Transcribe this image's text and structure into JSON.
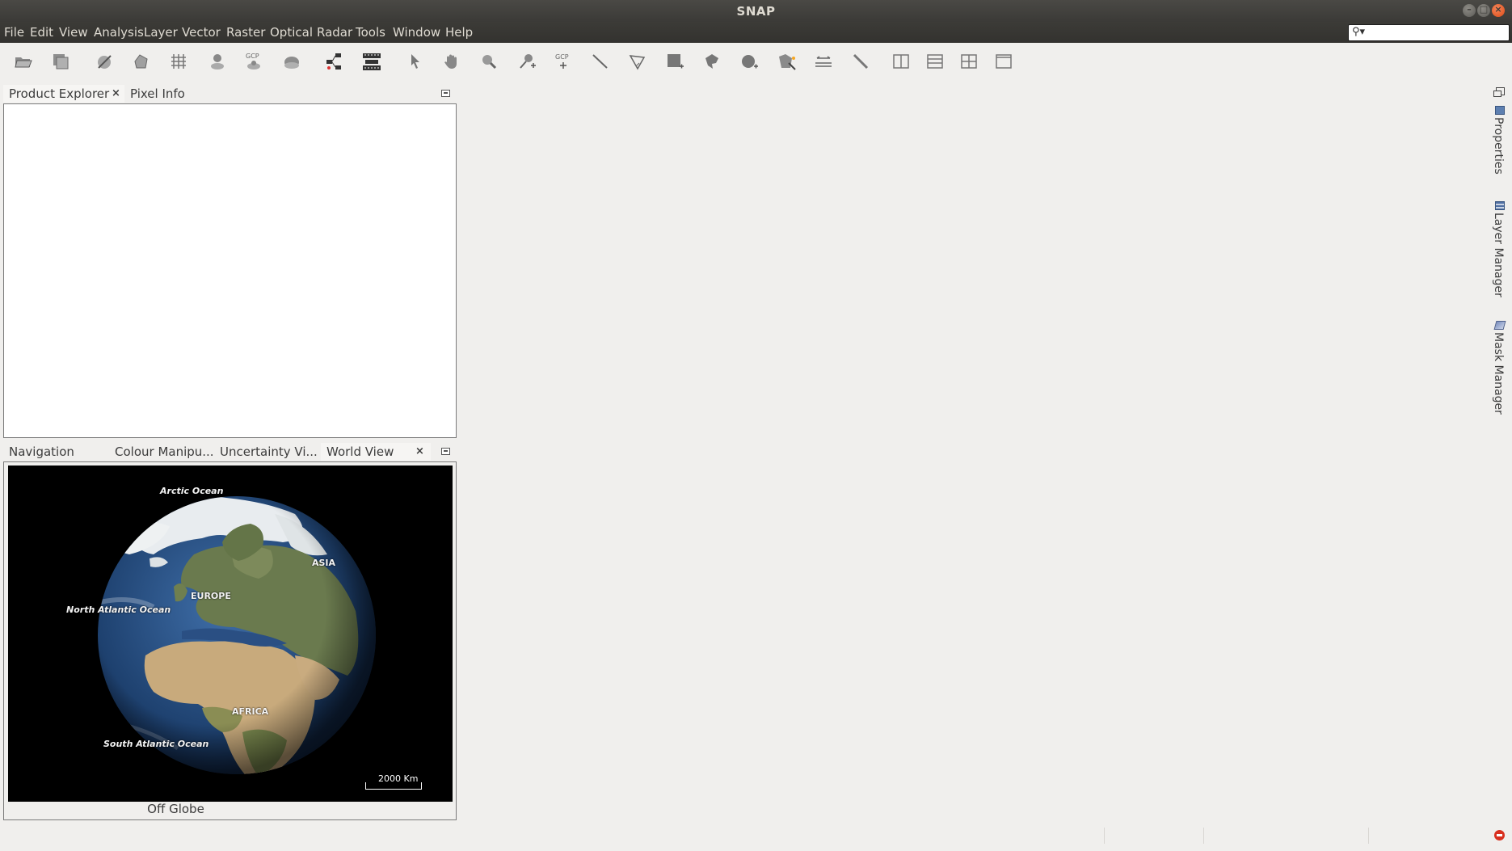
{
  "window": {
    "title": "SNAP"
  },
  "menubar": {
    "items": [
      "File",
      "Edit",
      "View",
      "Analysis",
      "Layer",
      "Vector",
      "Raster",
      "Optical",
      "Radar",
      "Tools",
      "Window",
      "Help"
    ]
  },
  "search": {
    "placeholder": ""
  },
  "toolbar": {
    "tools": [
      "open-product-icon",
      "save-product-icon",
      "mask-icon",
      "vector-icon",
      "graticule-icon",
      "pin-icon",
      "gcp-icon",
      "world-map-icon",
      "graph-builder-icon",
      "batch-processing-icon",
      "select-tool-icon",
      "pan-tool-icon",
      "zoom-tool-icon",
      "pin-placing-icon",
      "gcp-placing-icon",
      "line-drawing-icon",
      "polyline-drawing-icon",
      "rectangle-drawing-icon",
      "polygon-drawing-icon",
      "ellipse-drawing-icon",
      "magic-wand-icon",
      "range-finder-icon",
      "measure-icon",
      "tile-horizontal-icon",
      "tile-vertical-icon",
      "tile-grid-icon",
      "tile-single-icon"
    ],
    "gcp_text": "GCP"
  },
  "top_panel": {
    "tabs": [
      {
        "label": "Product Explorer",
        "active": true,
        "closable": true
      },
      {
        "label": "Pixel Info",
        "active": false,
        "closable": false
      }
    ]
  },
  "bottom_panel": {
    "tabs": [
      {
        "label": "Navigation",
        "active": false
      },
      {
        "label": "Colour Manipu...",
        "active": false
      },
      {
        "label": "Uncertainty Vi...",
        "active": false
      },
      {
        "label": "World View",
        "active": true,
        "closable": true
      }
    ],
    "globe_labels": {
      "arctic": "Arctic Ocean",
      "asia": "ASIA",
      "europe": "EUROPE",
      "north_atlantic": "North Atlantic Ocean",
      "africa": "AFRICA",
      "south_atlantic": "South Atlantic Ocean"
    },
    "scale": "2000 Km",
    "status_text": "Off Globe"
  },
  "right_sidebar": {
    "tabs": [
      "Properties",
      "Layer Manager",
      "Mask Manager"
    ]
  },
  "colors": {
    "titlebar": "#3b3a37",
    "menubar": "#35342f",
    "window_bg": "#f0efed",
    "close_button": "#dc4b17",
    "error_indicator": "#d8301f"
  }
}
